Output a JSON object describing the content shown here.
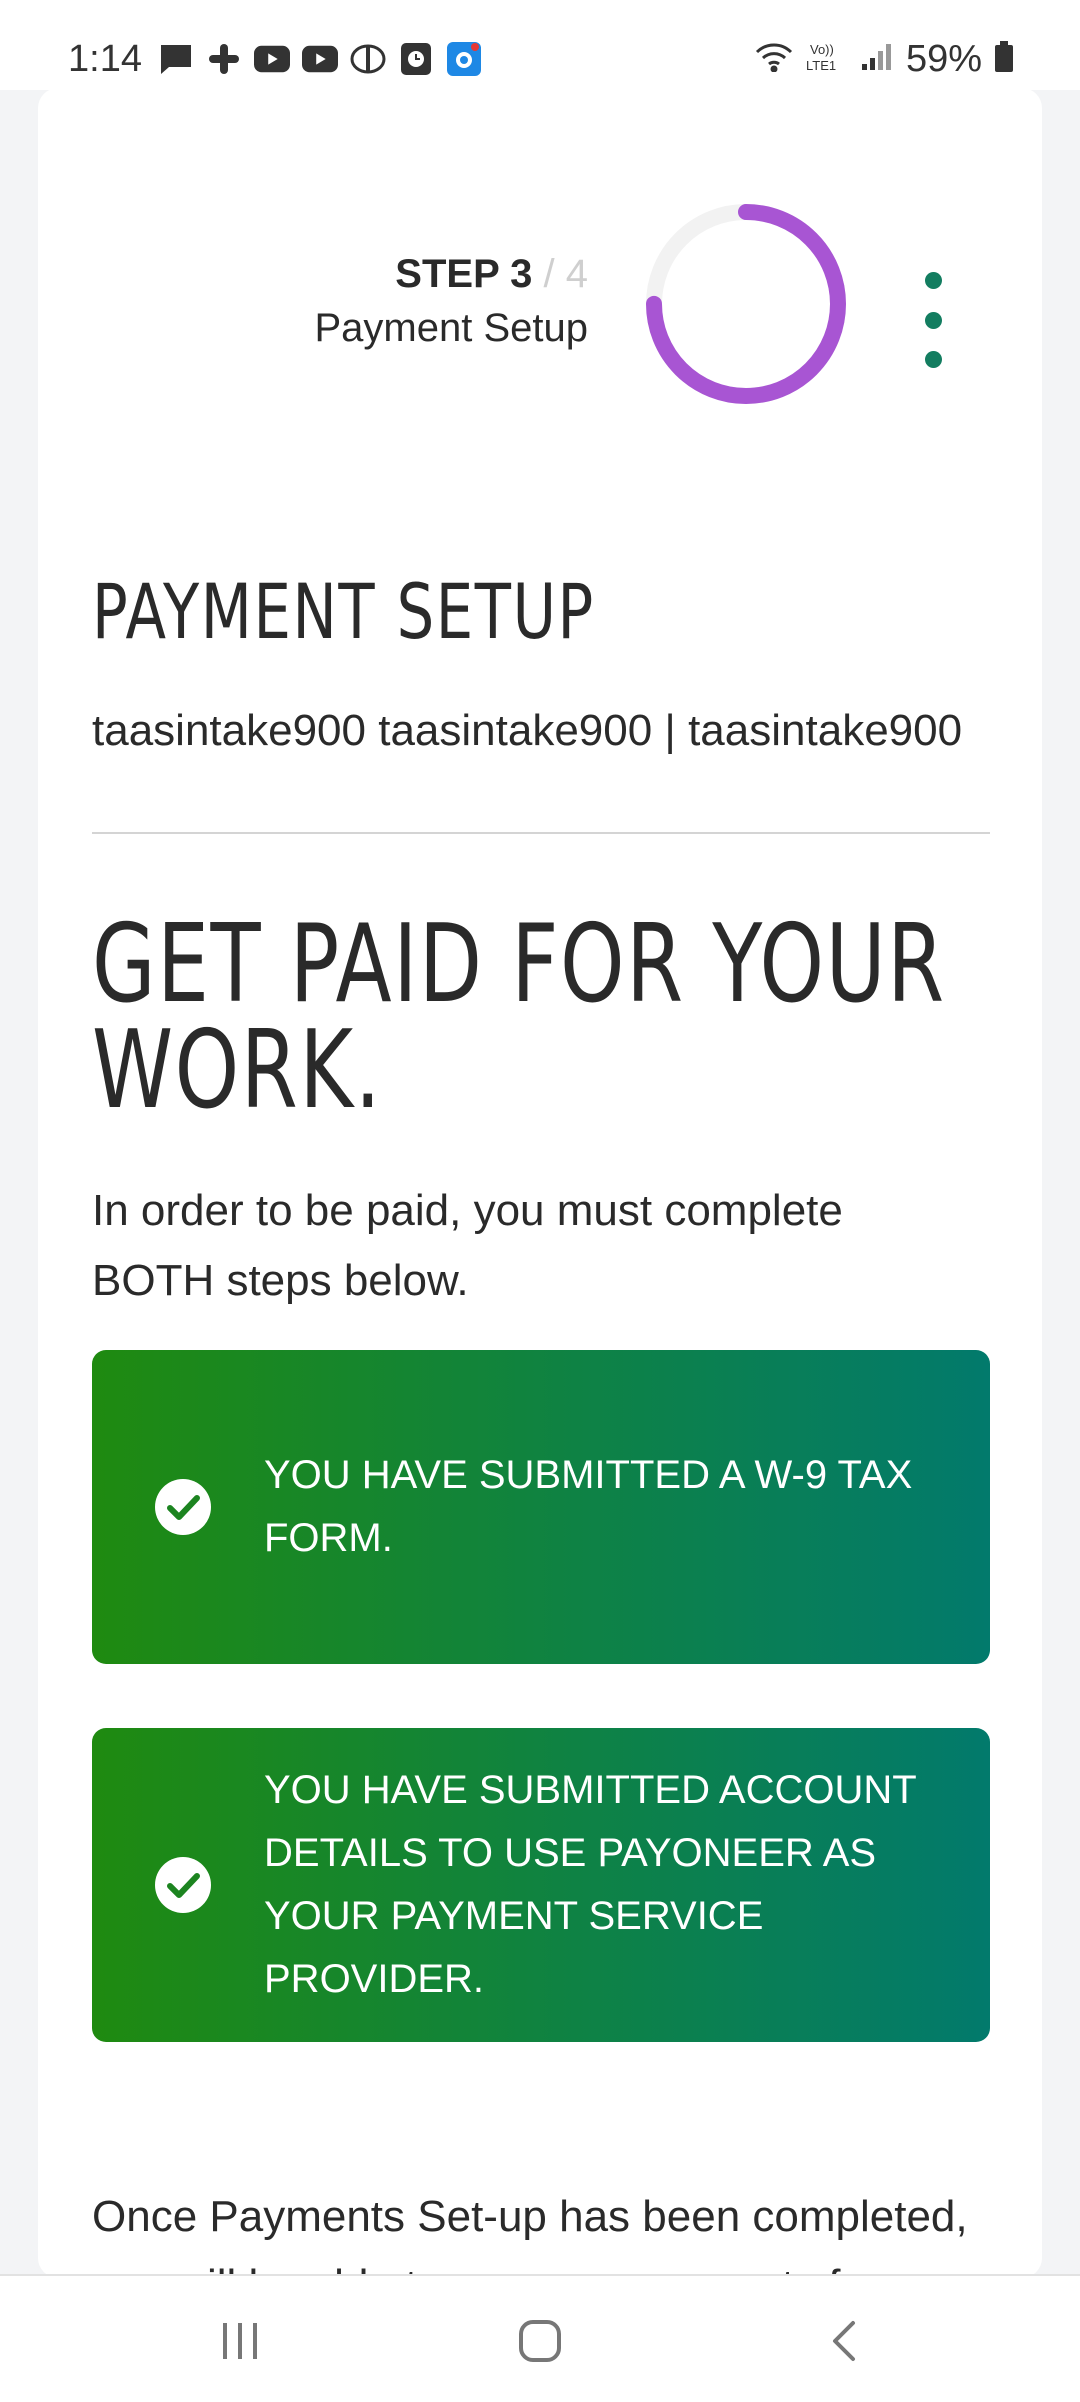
{
  "status_bar": {
    "time": "1:14",
    "battery": "59%",
    "notification_icons": [
      "message-icon",
      "slack-icon",
      "youtube-icon",
      "youtube-icon",
      "audio-icon",
      "clock-app-icon",
      "camera-app-icon"
    ],
    "right_icons": [
      "wifi-icon",
      "volte-icon",
      "signal-icon",
      "battery-icon"
    ]
  },
  "stepper": {
    "step_label": "STEP 3",
    "step_total": "/ 4",
    "step_name": "Payment Setup",
    "progress_fraction": 0.75,
    "progress_color": "#a855d3",
    "track_color": "#f2f2f2"
  },
  "menu": {
    "icon": "kebab-menu-icon",
    "color": "#137d60"
  },
  "page": {
    "section_title": "PAYMENT SETUP",
    "user_line": "taasintake900 taasintake900 | taasintake900",
    "heading": "GET PAID FOR YOUR WORK.",
    "intro": "In order to be paid, you must complete BOTH steps below.",
    "banners": [
      {
        "text": "YOU HAVE SUBMITTED A W-9 TAX FORM.",
        "icon": "check-circle-icon"
      },
      {
        "text": "YOU HAVE SUBMITTED ACCOUNT DETAILS TO USE PAYONEER AS YOUR PAYMENT SERVICE PROVIDER.",
        "icon": "check-circle-icon"
      }
    ],
    "outro": "Once Payments Set-up has been completed, you will be able to manage payments from your Topcoder account."
  },
  "nav_bar": {
    "recents": "recent-apps-icon",
    "home": "home-icon",
    "back": "back-icon"
  },
  "colors": {
    "banner_start": "#1f8a10",
    "banner_end": "#027a6c",
    "text": "#2a2a2a"
  }
}
